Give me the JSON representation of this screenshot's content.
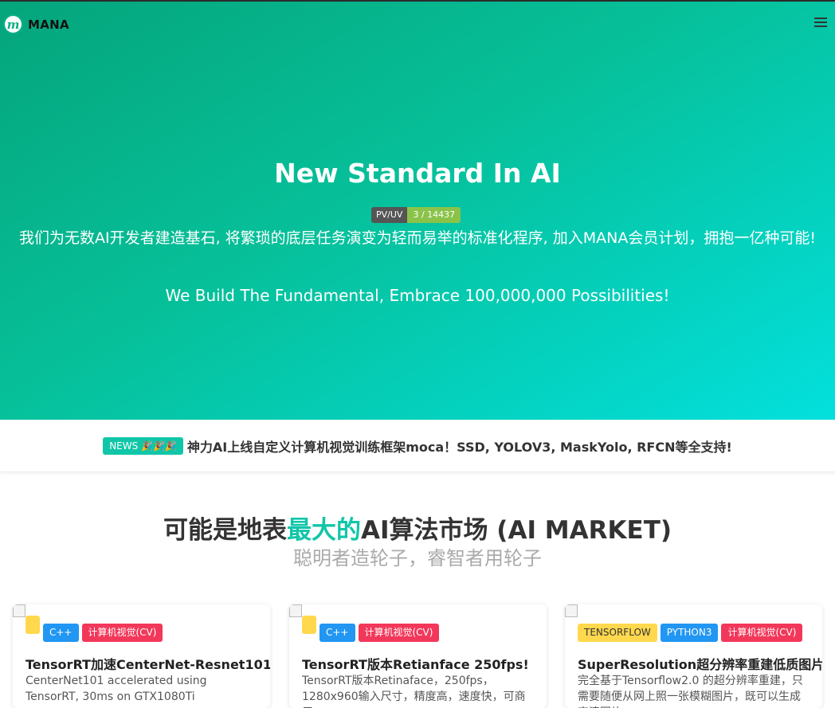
{
  "brand": {
    "logo_letter": "m",
    "name": "MANA"
  },
  "hero": {
    "title": "New Standard In AI",
    "pv_label": "PV/UV",
    "pv_value": "3 / 14437",
    "subtitle_cn": "我们为无数AI开发者建造基石, 将繁琐的底层任务演变为轻而易举的标准化程序, 加入MANA会员计划，拥抱一亿种可能!",
    "subtitle_en": "We Build The Fundamental, Embrace 100,000,000 Possibilities!"
  },
  "news": {
    "badge": "NEWS 🎉🎉🎉",
    "text": "神力AI上线自定义计算机视觉训练框架moca！SSD, YOLOV3, MaskYolo, RFCN等全支持!"
  },
  "market": {
    "title_pre": "可能是地表",
    "title_hl": "最大的",
    "title_post": "AI算法市场 (AI MARKET)",
    "subtitle": "聪明者造轮子，睿智者用轮子"
  },
  "cards": [
    {
      "tags": [
        "C++",
        "计算机视觉(CV)"
      ],
      "title": "TensorRT加速CenterNet-Resnet101",
      "desc": "CenterNet101 accelerated using TensorRT, 30ms on GTX1080Ti"
    },
    {
      "tags": [
        "C++",
        "计算机视觉(CV)"
      ],
      "title": "TensorRT版本Retianface 250fps!",
      "desc": "TensorRT版本Retinaface，250fps，1280x960输入尺寸，精度高，速度快，可商用"
    },
    {
      "tags": [
        "TENSORFLOW",
        "PYTHON3",
        "计算机视觉(CV)"
      ],
      "title": "SuperResolution超分辨率重建低质图片",
      "desc": "完全基于Tensorflow2.0 的超分辨率重建，只需要随便从网上照一张模糊图片，既可以生成高清图片"
    }
  ],
  "colors": {
    "accent": "#11c6a8",
    "hero_start": "#05a57b",
    "hero_end": "#03e0dd",
    "tag_blue": "#2196f3",
    "tag_red": "#f2385a",
    "tag_yellow": "#ffd84d"
  },
  "icons": {
    "menu": "hamburger-icon",
    "logo": "mana-logo-icon"
  }
}
